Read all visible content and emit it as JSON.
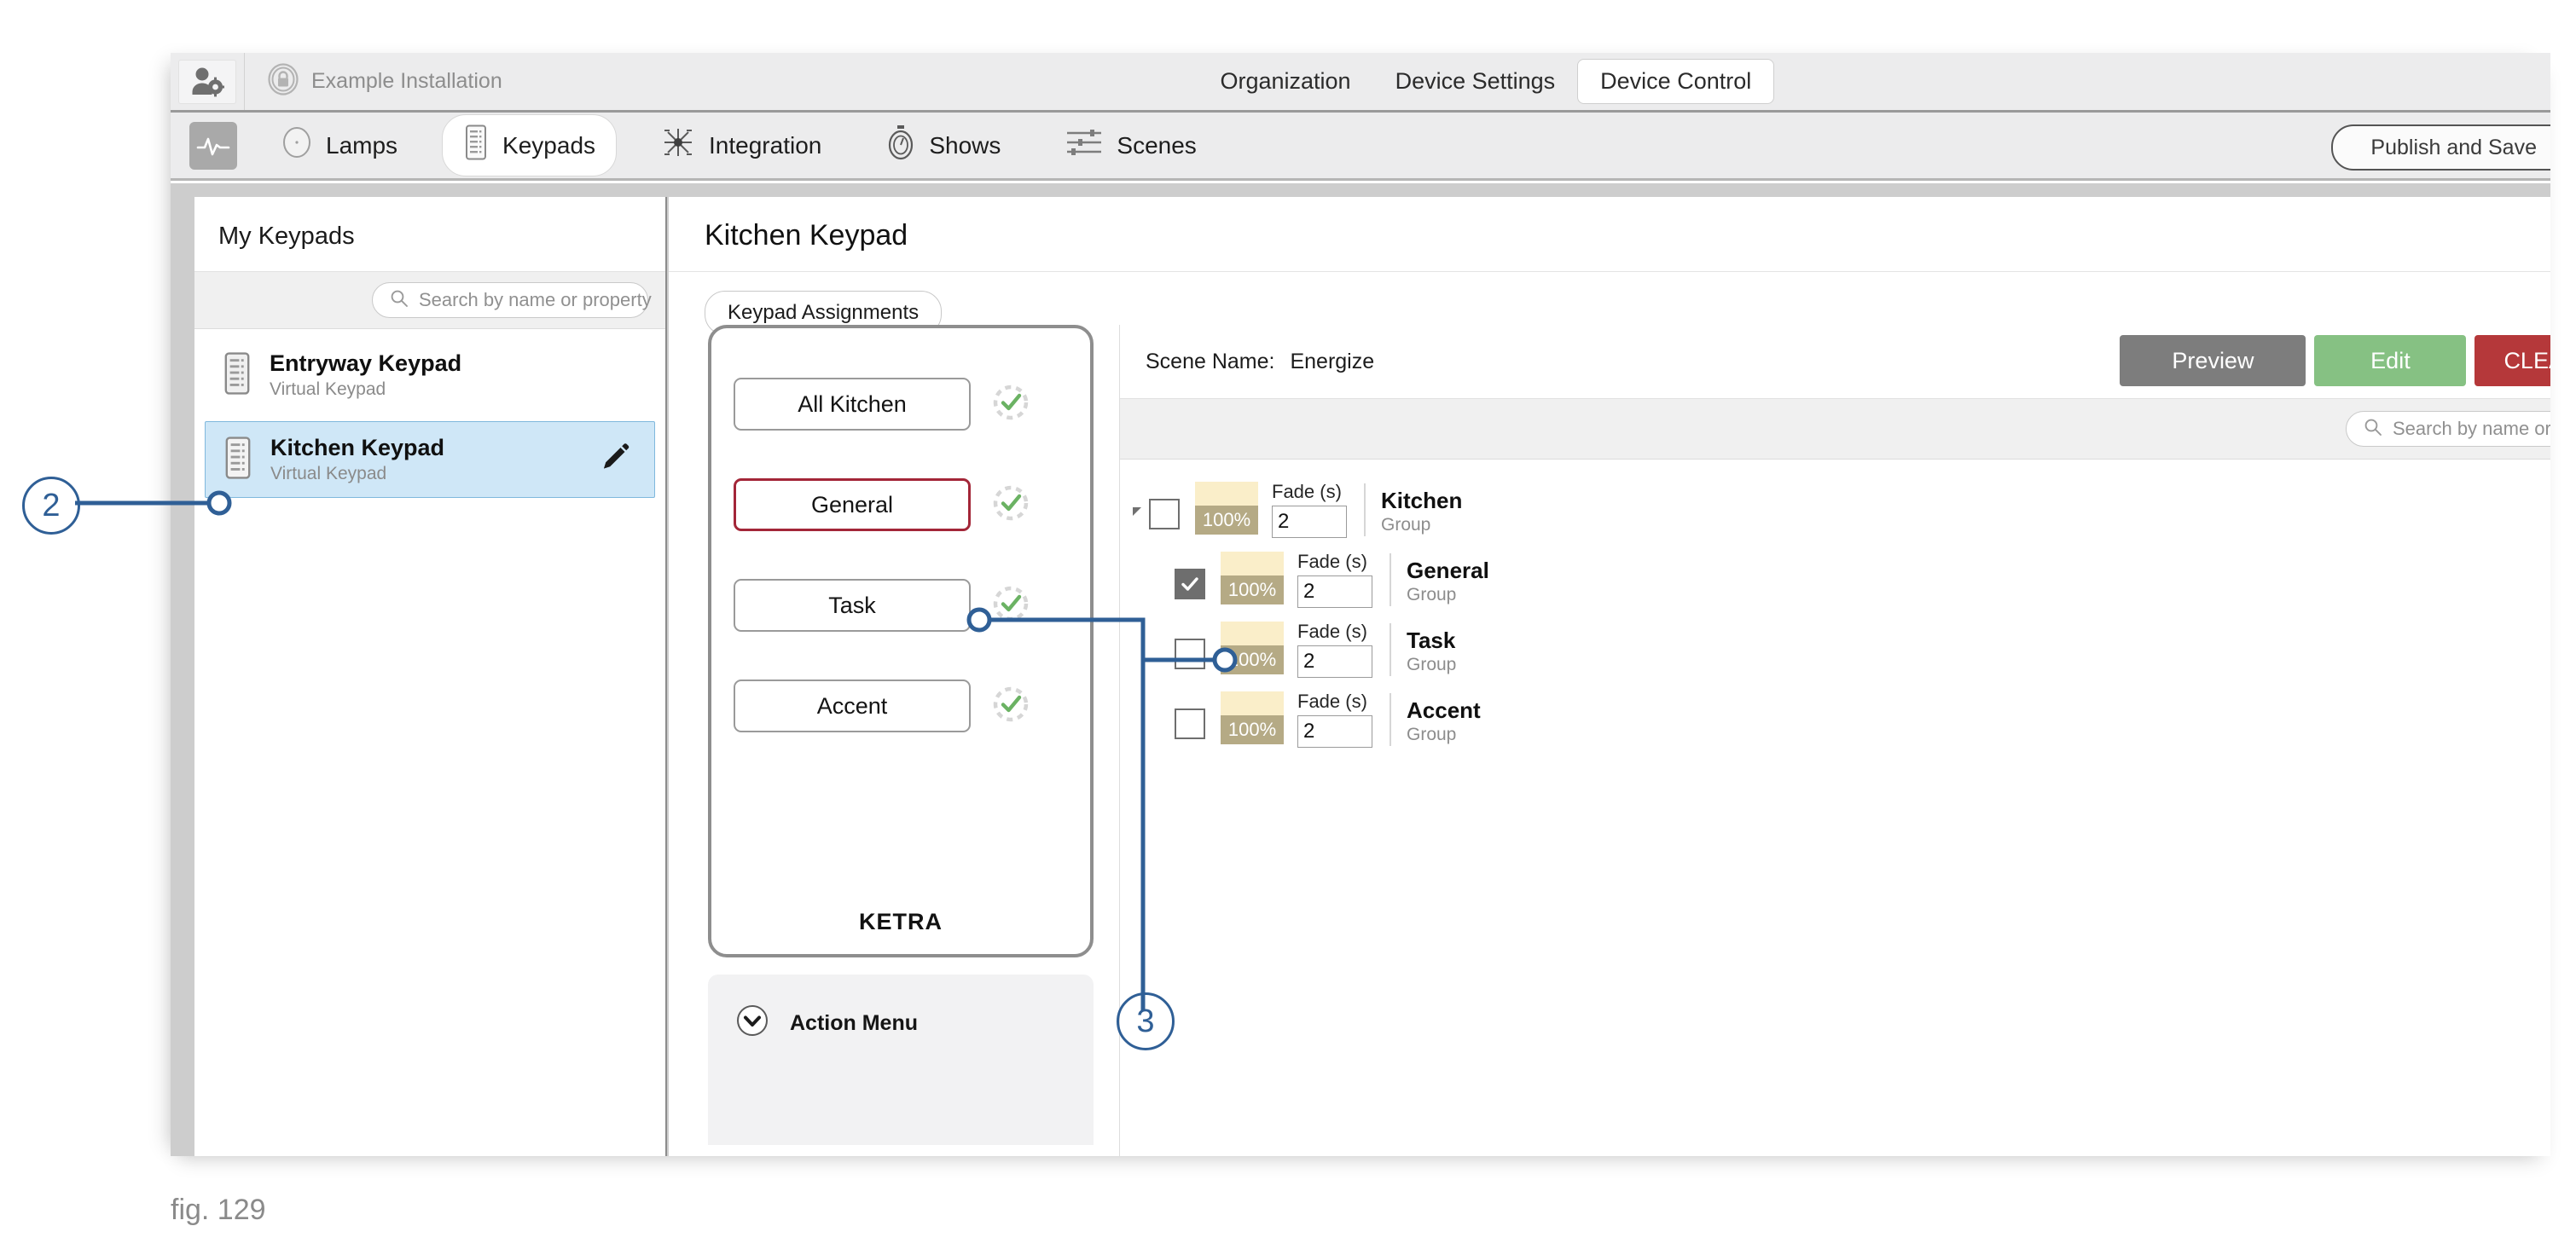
{
  "window": {
    "top_bar": {
      "user_settings_icon": "user-settings-icon",
      "installation_lock_icon": "lock-circle-icon",
      "installation_name": "Example Installation",
      "nav_tabs": [
        {
          "label": "Organization",
          "active": false
        },
        {
          "label": "Device Settings",
          "active": false
        },
        {
          "label": "Device Control",
          "active": true
        }
      ]
    },
    "section_bar": {
      "pulse_icon": "pulse-icon",
      "tabs": [
        {
          "label": "Lamps",
          "icon": "lamp-circle-icon",
          "active": false
        },
        {
          "label": "Keypads",
          "icon": "keypad-icon",
          "active": true
        },
        {
          "label": "Integration",
          "icon": "integration-node-icon",
          "active": false
        },
        {
          "label": "Shows",
          "icon": "stopwatch-icon",
          "active": false
        },
        {
          "label": "Scenes",
          "icon": "sliders-icon",
          "active": false
        }
      ],
      "publish_button": "Publish and Save"
    }
  },
  "sidebar": {
    "title": "My Keypads",
    "search_placeholder": "Search by name or property",
    "search_icon": "search-icon",
    "items": [
      {
        "name": "Entryway Keypad",
        "type": "Virtual Keypad",
        "icon": "keypad-icon",
        "selected": false,
        "edit_icon": ""
      },
      {
        "name": "Kitchen Keypad",
        "type": "Virtual Keypad",
        "icon": "keypad-icon",
        "selected": true,
        "edit_icon": "pencil-icon"
      }
    ]
  },
  "main": {
    "title": "Kitchen Keypad",
    "tab": "Keypad Assignments",
    "keypad_device": {
      "brand": "KETRA",
      "buttons": [
        {
          "label": "All Kitchen",
          "highlighted": false,
          "status_icon": "check-dashed-circle-icon"
        },
        {
          "label": "General",
          "highlighted": true,
          "status_icon": "check-dashed-circle-icon"
        },
        {
          "label": "Task",
          "highlighted": false,
          "status_icon": "check-dashed-circle-icon"
        },
        {
          "label": "Accent",
          "highlighted": false,
          "status_icon": "check-dashed-circle-icon"
        }
      ]
    },
    "action_menu": {
      "label": "Action Menu",
      "icon": "chevron-down-circle-icon"
    }
  },
  "scene_panel": {
    "scene_name_label": "Scene Name:",
    "scene_name_value": "Energize",
    "buttons": {
      "preview": "Preview",
      "edit": "Edit",
      "clear": "CLEAR SCENE"
    },
    "search_placeholder": "Search by name or property",
    "search_icon": "search-icon",
    "fade_label": "Fade (s)",
    "rows": [
      {
        "name": "Kitchen",
        "type": "Group",
        "checked": false,
        "has_disclosure": true,
        "brightness": "100%",
        "fade": "2"
      },
      {
        "name": "General",
        "type": "Group",
        "checked": true,
        "has_disclosure": false,
        "brightness": "100%",
        "fade": "2"
      },
      {
        "name": "Task",
        "type": "Group",
        "checked": false,
        "has_disclosure": false,
        "brightness": "100%",
        "fade": "2"
      },
      {
        "name": "Accent",
        "type": "Group",
        "checked": false,
        "has_disclosure": false,
        "brightness": "100%",
        "fade": "2"
      }
    ]
  },
  "annotations": {
    "callouts": [
      {
        "number": "2"
      },
      {
        "number": "3"
      }
    ],
    "figure_caption": "fig. 129",
    "line_color": "#2f5f96"
  },
  "colors": {
    "accent_blue": "#2f5f96",
    "selection_blue": "#cfe7f7",
    "highlight_red": "#a32638",
    "clear_red": "#b5383a",
    "edit_green": "#86c183",
    "preview_gray": "#7d7d7d",
    "swatch_cream": "#faeec9",
    "swatch_pct": "#b5aa85"
  }
}
